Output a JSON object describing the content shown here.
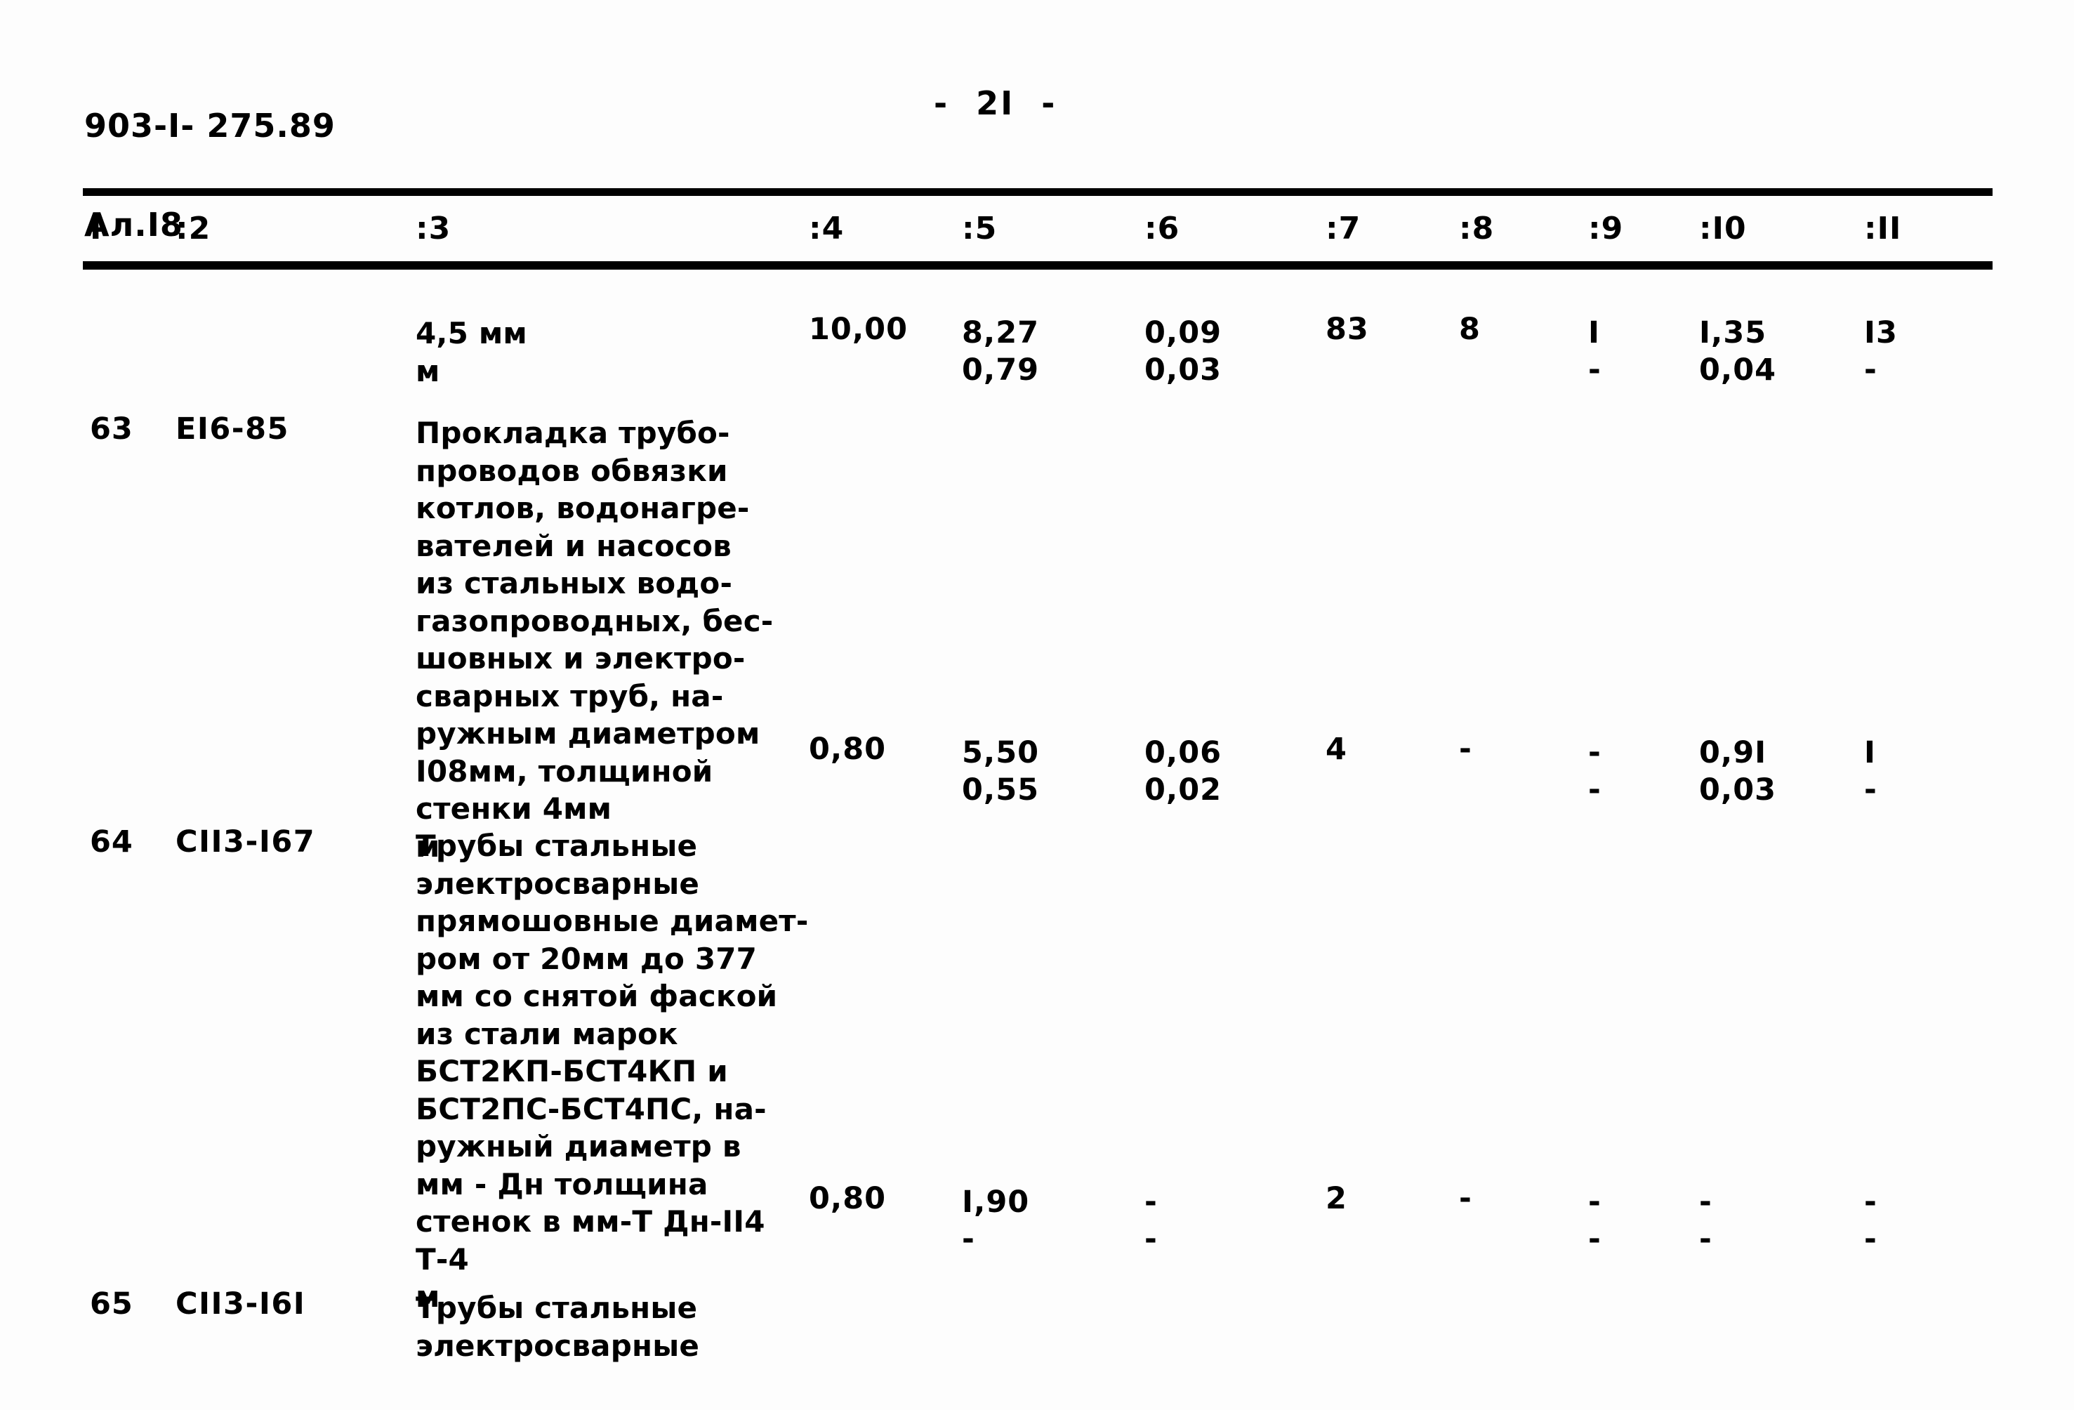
{
  "header": {
    "doc_code_line1": "903-I- 275.89",
    "doc_code_line2": "Ал.I8",
    "page_marker": "-  2I  -"
  },
  "table": {
    "columns": [
      "I",
      ":2",
      ":3",
      ":4",
      ":5",
      ":6",
      ":7",
      ":8",
      ":9",
      ":I0",
      ":II"
    ],
    "rows": [
      {
        "num": "",
        "code": "",
        "desc": "4,5 мм\nм",
        "c4": "10,00",
        "c5_a": "8,27",
        "c5_b": "0,79",
        "c6_a": "0,09",
        "c6_b": "0,03",
        "c7": "83",
        "c8": "8",
        "c9_a": "I",
        "c9_b": "-",
        "c10_a": "I,35",
        "c10_b": "0,04",
        "c11_a": "I3",
        "c11_b": "-"
      },
      {
        "num": "63",
        "code": "EI6-85",
        "desc": "Прокладка трубо-\nпроводов обвязки\nкотлов, водонагре-\nвателей и насосов\nиз стальных водо-\nгазопроводных, бес-\nшовных и электро-\nсварных труб, на-\nружным диаметром\nI08мм, толщиной\nстенки 4мм\nм",
        "c4": "0,80",
        "c5_a": "5,50",
        "c5_b": "0,55",
        "c6_a": "0,06",
        "c6_b": "0,02",
        "c7": "4",
        "c8": "-",
        "c9_a": "-",
        "c9_b": "-",
        "c10_a": "0,9I",
        "c10_b": "0,03",
        "c11_a": "I",
        "c11_b": "-"
      },
      {
        "num": "64",
        "code": "CII3-I67",
        "desc": "Трубы стальные\nэлектросварные\nпрямошовные диамет-\nром от 20мм до 377\nмм со снятой фаской\nиз стали марок\nБСТ2КП-БСТ4КП и\nБСТ2ПС-БСТ4ПС, на-\nружный диаметр в\nмм - Дн толщина\nстенок в мм-Т Дн-II4\nТ-4\nм",
        "c4": "0,80",
        "c5_a": "I,90",
        "c5_b": "-",
        "c6_a": "-",
        "c6_b": "-",
        "c7": "2",
        "c8": "-",
        "c9_a": "-",
        "c9_b": "-",
        "c10_a": "-",
        "c10_b": "-",
        "c11_a": "-",
        "c11_b": "-"
      },
      {
        "num": "65",
        "code": "CII3-I6I",
        "desc": "Трубы стальные\nэлектросварные",
        "c4": "",
        "c5_a": "",
        "c5_b": "",
        "c6_a": "",
        "c6_b": "",
        "c7": "",
        "c8": "",
        "c9_a": "",
        "c9_b": "",
        "c10_a": "",
        "c10_b": "",
        "c11_a": "",
        "c11_b": ""
      }
    ]
  }
}
